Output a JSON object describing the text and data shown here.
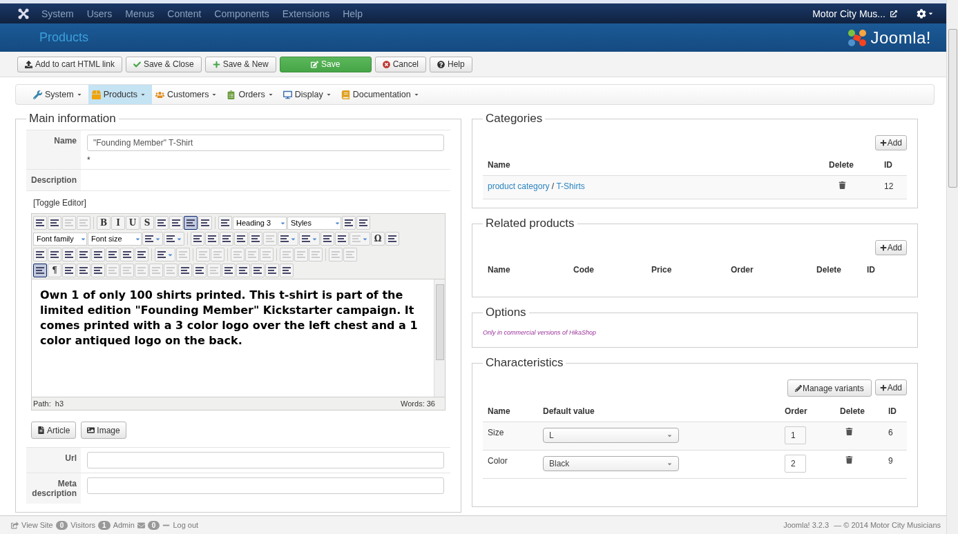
{
  "topnav": {
    "menus": [
      "System",
      "Users",
      "Menus",
      "Content",
      "Components",
      "Extensions",
      "Help"
    ],
    "site": "Motor City Mus..."
  },
  "header": {
    "title": "Products",
    "brand": "Joomla!"
  },
  "toolbar": [
    {
      "label": "Add to cart HTML link",
      "kind": "upload"
    },
    {
      "label": "Save & Close",
      "kind": "check"
    },
    {
      "label": "Save & New",
      "kind": "plus"
    },
    {
      "label": "Save",
      "kind": "save"
    },
    {
      "label": "Cancel",
      "kind": "cancel"
    },
    {
      "label": "Help",
      "kind": "help"
    }
  ],
  "submenu": [
    {
      "label": "System",
      "kind": "tools",
      "selected": false
    },
    {
      "label": "Products",
      "kind": "products",
      "selected": true
    },
    {
      "label": "Customers",
      "kind": "customers",
      "selected": false
    },
    {
      "label": "Orders",
      "kind": "orders",
      "selected": false
    },
    {
      "label": "Display",
      "kind": "display",
      "selected": false
    },
    {
      "label": "Documentation",
      "kind": "docs",
      "selected": false
    }
  ],
  "main_info": {
    "title": "Main information",
    "name_label": "Name",
    "name_value": "\"Founding Member\" T-Shirt",
    "required_mark": "*",
    "description_label": "Description",
    "toggle_editor": "[Toggle Editor]",
    "editor": {
      "toolbar_rows": [
        [
          {
            "kind": "icon",
            "disabled": false,
            "active": false
          },
          {
            "kind": "icon",
            "disabled": false,
            "active": false
          },
          {
            "kind": "icon",
            "disabled": true,
            "active": false
          },
          {
            "kind": "icon",
            "disabled": true,
            "active": false
          },
          {
            "kind": "sep"
          },
          {
            "kind": "text",
            "label": "B",
            "disabled": false,
            "active": false
          },
          {
            "kind": "text",
            "label": "I",
            "disabled": false,
            "active": false
          },
          {
            "kind": "text",
            "label": "U",
            "disabled": false,
            "active": false
          },
          {
            "kind": "text",
            "label": "S",
            "disabled": false,
            "active": false
          },
          {
            "kind": "icon",
            "disabled": false,
            "active": false
          },
          {
            "kind": "icon",
            "disabled": false,
            "active": false
          },
          {
            "kind": "icon",
            "disabled": false,
            "active": true
          },
          {
            "kind": "icon",
            "disabled": false,
            "active": false
          },
          {
            "kind": "sep"
          },
          {
            "kind": "icon",
            "disabled": false,
            "active": false
          },
          {
            "kind": "select",
            "label": "Heading 3"
          },
          {
            "kind": "select",
            "label": "Styles"
          },
          {
            "kind": "icon",
            "disabled": false,
            "active": false
          },
          {
            "kind": "icon",
            "disabled": false,
            "active": false
          }
        ],
        [
          {
            "kind": "select",
            "label": "Font family"
          },
          {
            "kind": "select",
            "label": "Font size"
          },
          {
            "kind": "icon_dd",
            "disabled": false,
            "active": false
          },
          {
            "kind": "icon_dd",
            "disabled": false,
            "active": false
          },
          {
            "kind": "sep"
          },
          {
            "kind": "icon",
            "disabled": false,
            "active": false
          },
          {
            "kind": "icon",
            "disabled": false,
            "active": false
          },
          {
            "kind": "icon",
            "disabled": false,
            "active": false
          },
          {
            "kind": "icon",
            "disabled": false,
            "active": false
          },
          {
            "kind": "icon",
            "disabled": false,
            "active": false
          },
          {
            "kind": "icon",
            "disabled": true,
            "active": false
          },
          {
            "kind": "icon_dd",
            "disabled": false,
            "active": false
          },
          {
            "kind": "icon_dd",
            "disabled": false,
            "active": false
          },
          {
            "kind": "icon",
            "disabled": false,
            "active": false
          },
          {
            "kind": "icon",
            "disabled": false,
            "active": false
          },
          {
            "kind": "icon_dd",
            "disabled": true,
            "active": false
          },
          {
            "kind": "text",
            "label": "Ω",
            "disabled": false,
            "active": false
          },
          {
            "kind": "icon",
            "disabled": false,
            "active": false
          }
        ],
        [
          {
            "kind": "icon",
            "disabled": false,
            "active": false
          },
          {
            "kind": "icon",
            "disabled": false,
            "active": false
          },
          {
            "kind": "icon",
            "disabled": false,
            "active": false
          },
          {
            "kind": "icon",
            "disabled": false,
            "active": false
          },
          {
            "kind": "icon",
            "disabled": false,
            "active": false
          },
          {
            "kind": "icon",
            "disabled": false,
            "active": false
          },
          {
            "kind": "icon",
            "disabled": false,
            "active": false
          },
          {
            "kind": "icon",
            "disabled": false,
            "active": false
          },
          {
            "kind": "sep"
          },
          {
            "kind": "icon_dd",
            "disabled": false,
            "active": false
          },
          {
            "kind": "icon",
            "disabled": true,
            "active": false
          },
          {
            "kind": "sep"
          },
          {
            "kind": "icon",
            "disabled": true,
            "active": false
          },
          {
            "kind": "icon",
            "disabled": true,
            "active": false
          },
          {
            "kind": "sep"
          },
          {
            "kind": "icon",
            "disabled": true,
            "active": false
          },
          {
            "kind": "icon",
            "disabled": true,
            "active": false
          },
          {
            "kind": "icon",
            "disabled": true,
            "active": false
          },
          {
            "kind": "sep"
          },
          {
            "kind": "icon",
            "disabled": true,
            "active": false
          },
          {
            "kind": "icon",
            "disabled": true,
            "active": false
          },
          {
            "kind": "icon",
            "disabled": true,
            "active": false
          },
          {
            "kind": "sep"
          },
          {
            "kind": "icon",
            "disabled": true,
            "active": false
          },
          {
            "kind": "icon",
            "disabled": true,
            "active": false
          }
        ],
        [
          {
            "kind": "icon",
            "disabled": false,
            "active": true
          },
          {
            "kind": "text",
            "label": "¶",
            "disabled": false,
            "active": false
          },
          {
            "kind": "icon",
            "disabled": false,
            "active": false
          },
          {
            "kind": "icon",
            "disabled": false,
            "active": false
          },
          {
            "kind": "icon",
            "disabled": false,
            "active": false
          },
          {
            "kind": "icon",
            "disabled": true,
            "active": false
          },
          {
            "kind": "icon",
            "disabled": true,
            "active": false
          },
          {
            "kind": "icon",
            "disabled": true,
            "active": false
          },
          {
            "kind": "icon",
            "disabled": true,
            "active": false
          },
          {
            "kind": "icon",
            "disabled": true,
            "active": false
          },
          {
            "kind": "icon",
            "disabled": false,
            "active": false
          },
          {
            "kind": "icon",
            "disabled": false,
            "active": false
          },
          {
            "kind": "icon",
            "disabled": true,
            "active": false
          },
          {
            "kind": "icon",
            "disabled": false,
            "active": false
          },
          {
            "kind": "icon",
            "disabled": false,
            "active": false
          },
          {
            "kind": "icon",
            "disabled": false,
            "active": false
          },
          {
            "kind": "icon",
            "disabled": false,
            "active": false
          },
          {
            "kind": "icon",
            "disabled": false,
            "active": false
          }
        ]
      ],
      "content": "Own 1 of only 100 shirts printed. This t-shirt is part of the limited edition \"Founding Member\" Kickstarter campaign. It comes printed with a 3 color logo over the left chest and a 1 color antiqued logo on the back.",
      "path": "Path:  h3",
      "words": "Words: 36"
    },
    "insert_buttons": [
      {
        "label": "Article",
        "kind": "article"
      },
      {
        "label": "Image",
        "kind": "image"
      }
    ],
    "url_label": "Url",
    "meta_label": "Meta description"
  },
  "categories": {
    "title": "Categories",
    "add": "Add",
    "columns": [
      "Name",
      "Delete",
      "ID"
    ],
    "rows": [
      {
        "parent": "product category",
        "separator": "/",
        "name": "T-Shirts",
        "id": "12"
      }
    ]
  },
  "related": {
    "title": "Related products",
    "add": "Add",
    "columns": [
      "Name",
      "Code",
      "Price",
      "Order",
      "Delete",
      "ID"
    ]
  },
  "options": {
    "title": "Options",
    "note": "Only in commercial versions of HikaShop"
  },
  "characteristics": {
    "title": "Characteristics",
    "manage": "Manage variants",
    "add": "Add",
    "columns": [
      "Name",
      "Default value",
      "Order",
      "Delete",
      "ID"
    ],
    "rows": [
      {
        "name": "Size",
        "value": "L",
        "order": "1",
        "id": "6"
      },
      {
        "name": "Color",
        "value": "Black",
        "order": "2",
        "id": "9"
      }
    ]
  },
  "status_bar": {
    "view_site": "View Site",
    "visitors_count": "0",
    "visitors": "Visitors",
    "admin_count": "1",
    "admin": "Admin",
    "messages_count": "0",
    "logout": "Log out",
    "version": "Joomla! 3.2.3",
    "copyright": "— © 2014 Motor City Musicians"
  }
}
